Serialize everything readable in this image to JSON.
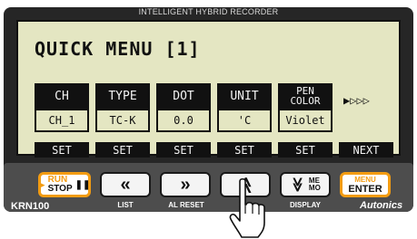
{
  "device": {
    "top_label": "INTELLIGENT HYBRID RECORDER",
    "model": "KRN100",
    "brand": "Autonics"
  },
  "screen": {
    "title": "QUICK MENU [1]",
    "columns": [
      {
        "header": "CH",
        "value": "CH_1"
      },
      {
        "header": "TYPE",
        "value": "TC-K"
      },
      {
        "header": "DOT",
        "value": "0.0"
      },
      {
        "header": "UNIT",
        "value": "'C"
      },
      {
        "header": "PEN\nCOLOR",
        "value": "Violet"
      }
    ],
    "more_indicator": "▶▷▷▷",
    "softkeys": [
      "SET",
      "SET",
      "SET",
      "SET",
      "SET",
      "NEXT"
    ]
  },
  "keys": {
    "run_label": "RUN",
    "stop_label": "STOP",
    "left_glyph": "«",
    "right_glyph": "»",
    "up_glyph": "≪",
    "down_glyph": "≫",
    "memo_label": "ME\nMO",
    "menu_label": "MENU",
    "enter_label": "ENTER",
    "sub_labels": [
      "LIST",
      "AL RESET",
      "DISPLAY"
    ]
  },
  "colors": {
    "lcd_bg": "#e4e6c2",
    "accent_orange": "#f39c12",
    "bezel": "#262626"
  }
}
